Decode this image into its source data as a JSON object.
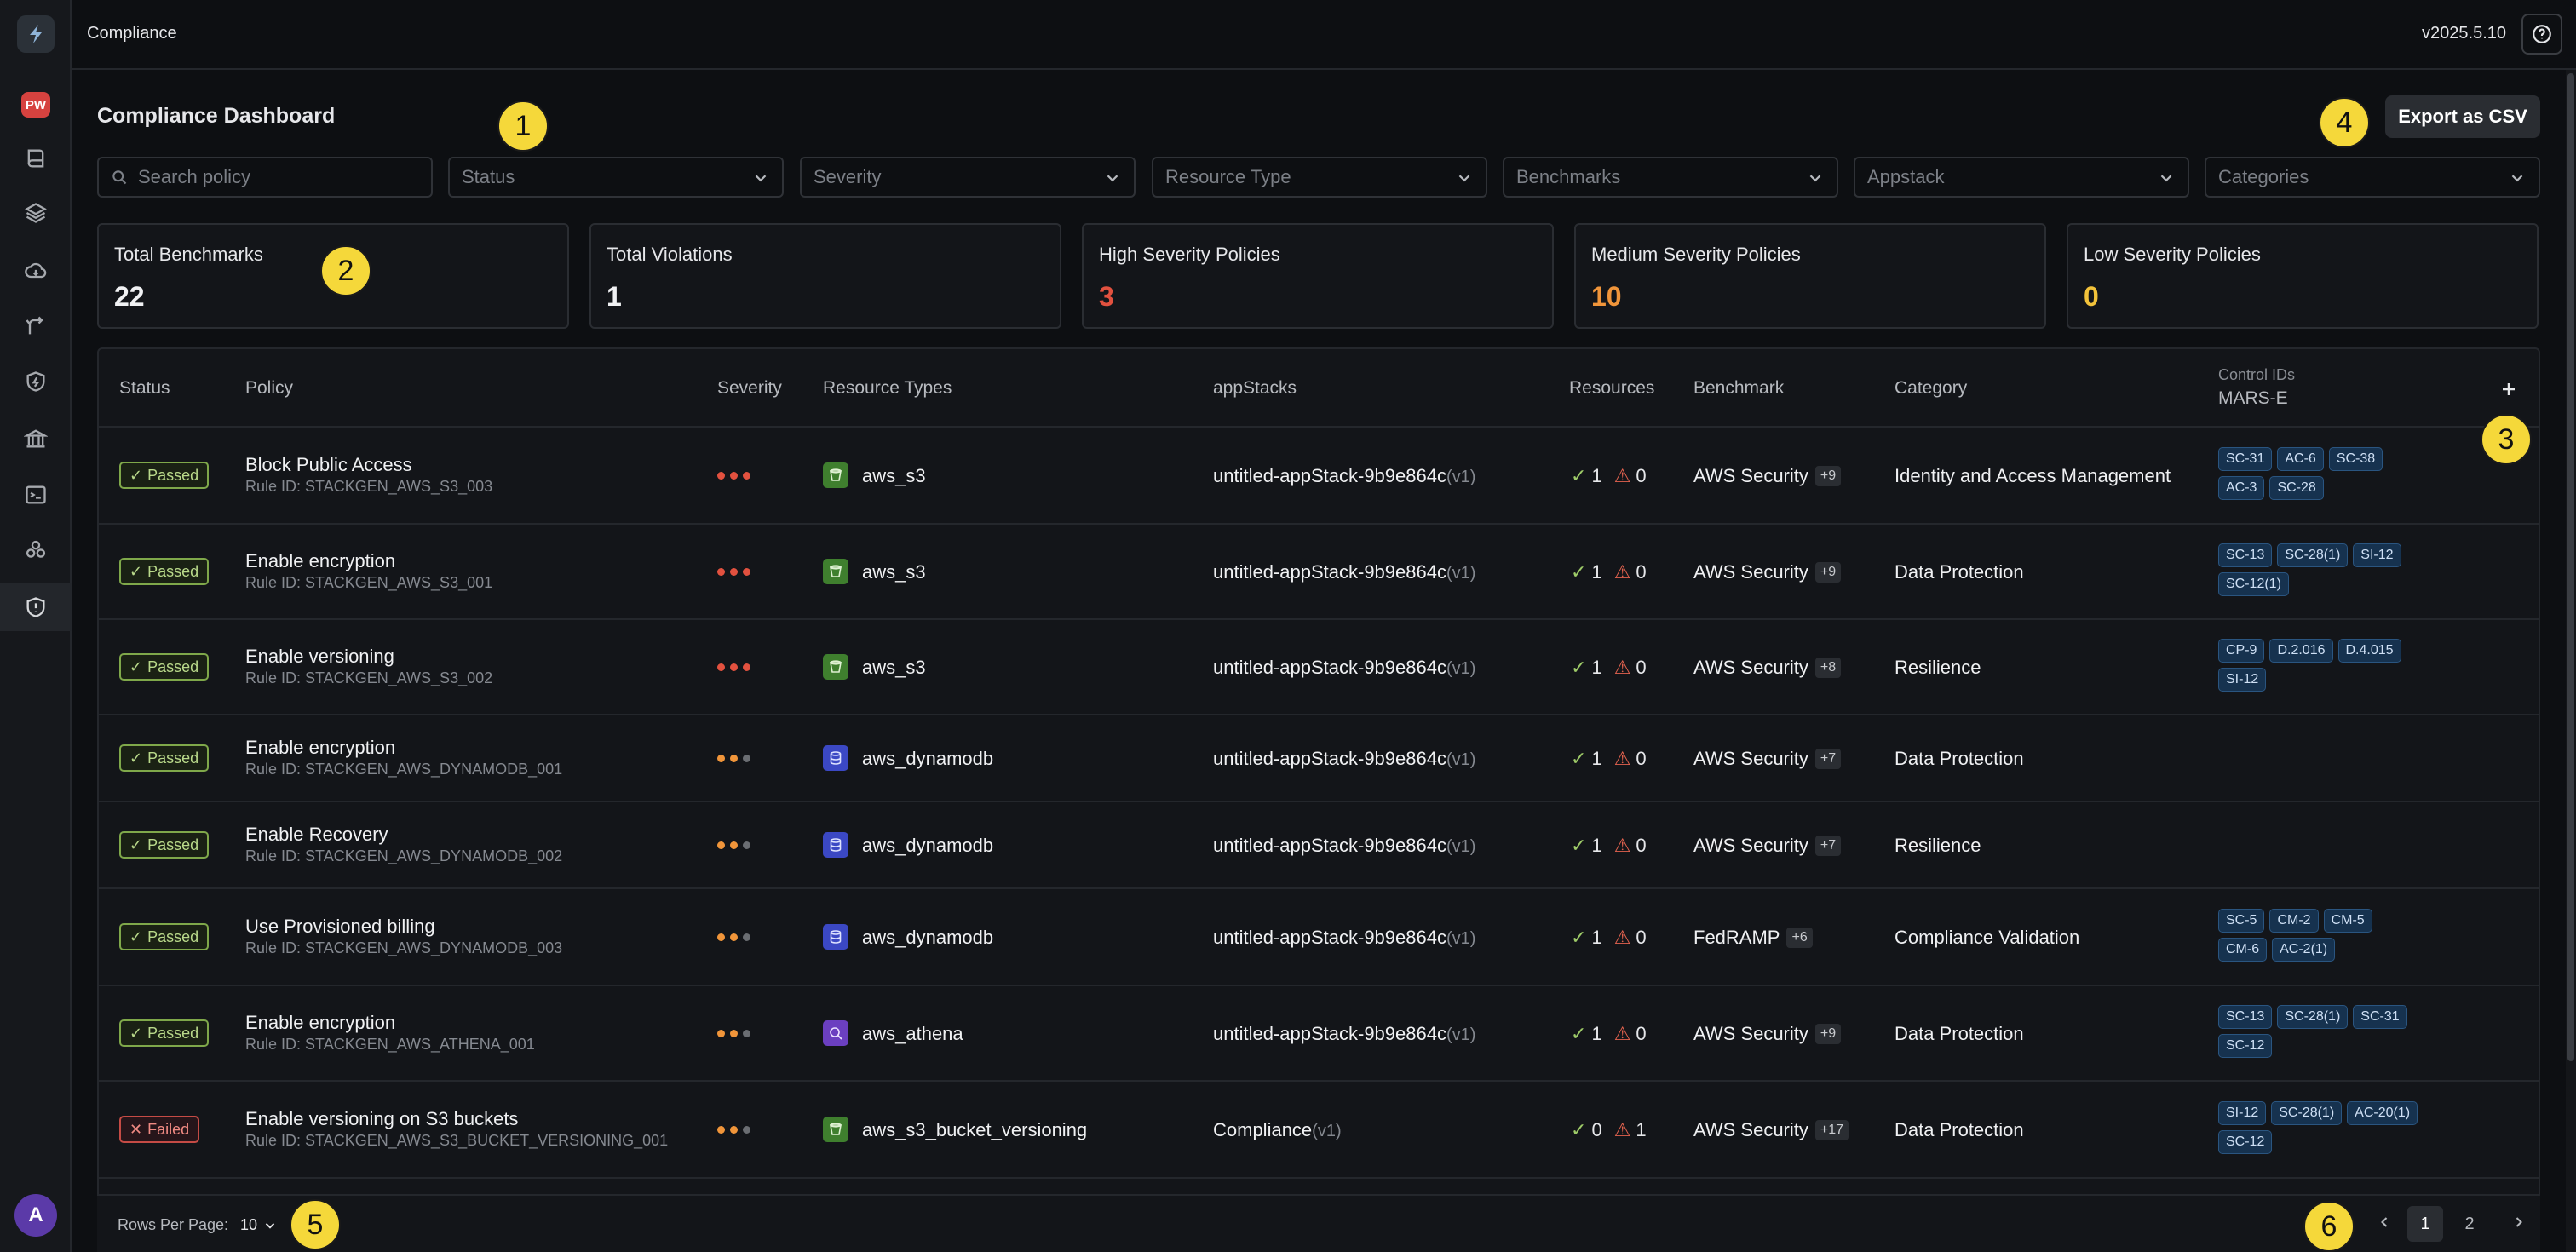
{
  "topbar": {
    "title": "Compliance",
    "version": "v2025.5.10"
  },
  "sidebar": {
    "workspace_badge": "PW",
    "avatar_initial": "A",
    "items": [
      {
        "name": "docs-icon"
      },
      {
        "name": "layers-icon"
      },
      {
        "name": "cloud-icon"
      },
      {
        "name": "git-branch-icon"
      },
      {
        "name": "shield-bolt-icon"
      },
      {
        "name": "bank-icon"
      },
      {
        "name": "terminal-icon"
      },
      {
        "name": "cluster-icon"
      },
      {
        "name": "shield-alert-icon"
      }
    ]
  },
  "page": {
    "title": "Compliance Dashboard",
    "export_label": "Export as CSV"
  },
  "filters": {
    "search_placeholder": "Search policy",
    "status": "Status",
    "severity": "Severity",
    "resource_type": "Resource Type",
    "benchmarks": "Benchmarks",
    "appstack": "Appstack",
    "categories": "Categories"
  },
  "stats": [
    {
      "label": "Total Benchmarks",
      "value": "22",
      "color": "#f0f1f3"
    },
    {
      "label": "Total Violations",
      "value": "1",
      "color": "#f0f1f3"
    },
    {
      "label": "High Severity Policies",
      "value": "3",
      "color": "#e2513f"
    },
    {
      "label": "Medium Severity Policies",
      "value": "10",
      "color": "#f0953a"
    },
    {
      "label": "Low Severity Policies",
      "value": "0",
      "color": "#f2c23a"
    }
  ],
  "table": {
    "columns": {
      "status": "Status",
      "policy": "Policy",
      "severity": "Severity",
      "resource_types": "Resource Types",
      "appstacks": "appStacks",
      "resources": "Resources",
      "benchmark": "Benchmark",
      "category": "Category",
      "control_ids": "Control IDs",
      "control_ids_sub": "MARS-E"
    },
    "rows": [
      {
        "status": "Passed",
        "policy": "Block Public Access",
        "rule_id": "Rule ID: STACKGEN_AWS_S3_003",
        "severity": "high",
        "resource": "aws_s3",
        "resource_icon": "s3-bucket-icon",
        "appstack": "untitled-appStack-9b9e864c",
        "appstack_ver": "(v1)",
        "ok": "1",
        "warn": "0",
        "benchmark": "AWS Security",
        "bench_more": "+9",
        "category": "Identity and Access Management",
        "controls": [
          "SC-31",
          "AC-6",
          "SC-38",
          "AC-3",
          "SC-28"
        ]
      },
      {
        "status": "Passed",
        "policy": "Enable encryption",
        "rule_id": "Rule ID: STACKGEN_AWS_S3_001",
        "severity": "high",
        "resource": "aws_s3",
        "resource_icon": "s3-bucket-icon",
        "appstack": "untitled-appStack-9b9e864c",
        "appstack_ver": "(v1)",
        "ok": "1",
        "warn": "0",
        "benchmark": "AWS Security",
        "bench_more": "+9",
        "category": "Data Protection",
        "controls": [
          "SC-13",
          "SC-28(1)",
          "SI-12",
          "SC-12(1)"
        ]
      },
      {
        "status": "Passed",
        "policy": "Enable versioning",
        "rule_id": "Rule ID: STACKGEN_AWS_S3_002",
        "severity": "high",
        "resource": "aws_s3",
        "resource_icon": "s3-bucket-icon",
        "appstack": "untitled-appStack-9b9e864c",
        "appstack_ver": "(v1)",
        "ok": "1",
        "warn": "0",
        "benchmark": "AWS Security",
        "bench_more": "+8",
        "category": "Resilience",
        "controls": [
          "CP-9",
          "D.2.016",
          "D.4.015",
          "SI-12"
        ]
      },
      {
        "status": "Passed",
        "policy": "Enable encryption",
        "rule_id": "Rule ID: STACKGEN_AWS_DYNAMODB_001",
        "severity": "medium",
        "resource": "aws_dynamodb",
        "resource_icon": "dynamodb-icon",
        "appstack": "untitled-appStack-9b9e864c",
        "appstack_ver": "(v1)",
        "ok": "1",
        "warn": "0",
        "benchmark": "AWS Security",
        "bench_more": "+7",
        "category": "Data Protection",
        "controls": []
      },
      {
        "status": "Passed",
        "policy": "Enable Recovery",
        "rule_id": "Rule ID: STACKGEN_AWS_DYNAMODB_002",
        "severity": "medium",
        "resource": "aws_dynamodb",
        "resource_icon": "dynamodb-icon",
        "appstack": "untitled-appStack-9b9e864c",
        "appstack_ver": "(v1)",
        "ok": "1",
        "warn": "0",
        "benchmark": "AWS Security",
        "bench_more": "+7",
        "category": "Resilience",
        "controls": []
      },
      {
        "status": "Passed",
        "policy": "Use Provisioned billing",
        "rule_id": "Rule ID: STACKGEN_AWS_DYNAMODB_003",
        "severity": "medium",
        "resource": "aws_dynamodb",
        "resource_icon": "dynamodb-icon",
        "appstack": "untitled-appStack-9b9e864c",
        "appstack_ver": "(v1)",
        "ok": "1",
        "warn": "0",
        "benchmark": "FedRAMP",
        "bench_more": "+6",
        "category": "Compliance Validation",
        "controls": [
          "SC-5",
          "CM-2",
          "CM-5",
          "CM-6",
          "AC-2(1)"
        ]
      },
      {
        "status": "Passed",
        "policy": "Enable encryption",
        "rule_id": "Rule ID: STACKGEN_AWS_ATHENA_001",
        "severity": "medium",
        "resource": "aws_athena",
        "resource_icon": "athena-icon",
        "appstack": "untitled-appStack-9b9e864c",
        "appstack_ver": "(v1)",
        "ok": "1",
        "warn": "0",
        "benchmark": "AWS Security",
        "bench_more": "+9",
        "category": "Data Protection",
        "controls": [
          "SC-13",
          "SC-28(1)",
          "SC-31",
          "SC-12"
        ]
      },
      {
        "status": "Failed",
        "policy": "Enable versioning on S3 buckets",
        "rule_id": "Rule ID: STACKGEN_AWS_S3_BUCKET_VERSIONING_001",
        "severity": "medium",
        "resource": "aws_s3_bucket_versioning",
        "resource_icon": "s3-bucket-icon",
        "appstack": "Compliance",
        "appstack_ver": "(v1)",
        "ok": "0",
        "warn": "1",
        "benchmark": "AWS Security",
        "bench_more": "+17",
        "category": "Data Protection",
        "controls": [
          "SI-12",
          "SC-28(1)",
          "AC-20(1)",
          "SC-12"
        ]
      }
    ]
  },
  "footer": {
    "rows_per_page_label": "Rows Per Page:",
    "rows_per_page": "10",
    "pages": [
      "1",
      "2"
    ],
    "current_page": "1"
  },
  "markers": [
    "1",
    "2",
    "3",
    "4",
    "5",
    "6"
  ]
}
